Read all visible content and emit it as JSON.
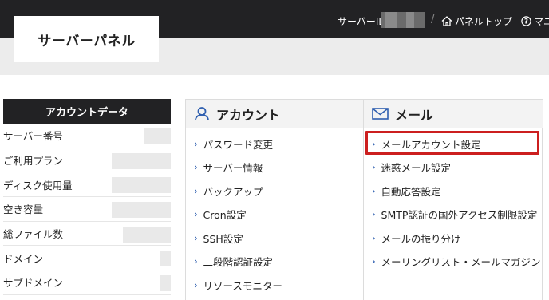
{
  "header": {
    "server_id_label": "サーバーID",
    "separator": "/",
    "panel_top_label": "パネルトップ",
    "manual_label": "マニ"
  },
  "logo": {
    "text": "サーバーパネル"
  },
  "account": {
    "title": "アカウントデータ",
    "rows": [
      {
        "label": "サーバー番号"
      },
      {
        "label": "ご利用プラン"
      },
      {
        "label": "ディスク使用量"
      },
      {
        "label": "空き容量"
      },
      {
        "label": "総ファイル数"
      },
      {
        "label": "ドメイン"
      },
      {
        "label": "サブドメイン"
      }
    ]
  },
  "menu": {
    "account": {
      "title": "アカウント",
      "items": [
        "パスワード変更",
        "サーバー情報",
        "バックアップ",
        "Cron設定",
        "SSH設定",
        "二段階認証設定",
        "リソースモニター"
      ]
    },
    "mail": {
      "title": "メール",
      "items": [
        "メールアカウント設定",
        "迷惑メール設定",
        "自動応答設定",
        "SMTP認証の国外アクセス制限設定",
        "メールの振り分け",
        "メーリングリスト・メールマガジン"
      ]
    }
  },
  "colors": {
    "topbar": "#222224",
    "chevron": "#2f5fb0",
    "highlight": "#cc1f1f"
  },
  "icons": {
    "account": "user-icon",
    "mail": "envelope-icon",
    "home": "home-icon",
    "help": "help-circle-icon"
  }
}
